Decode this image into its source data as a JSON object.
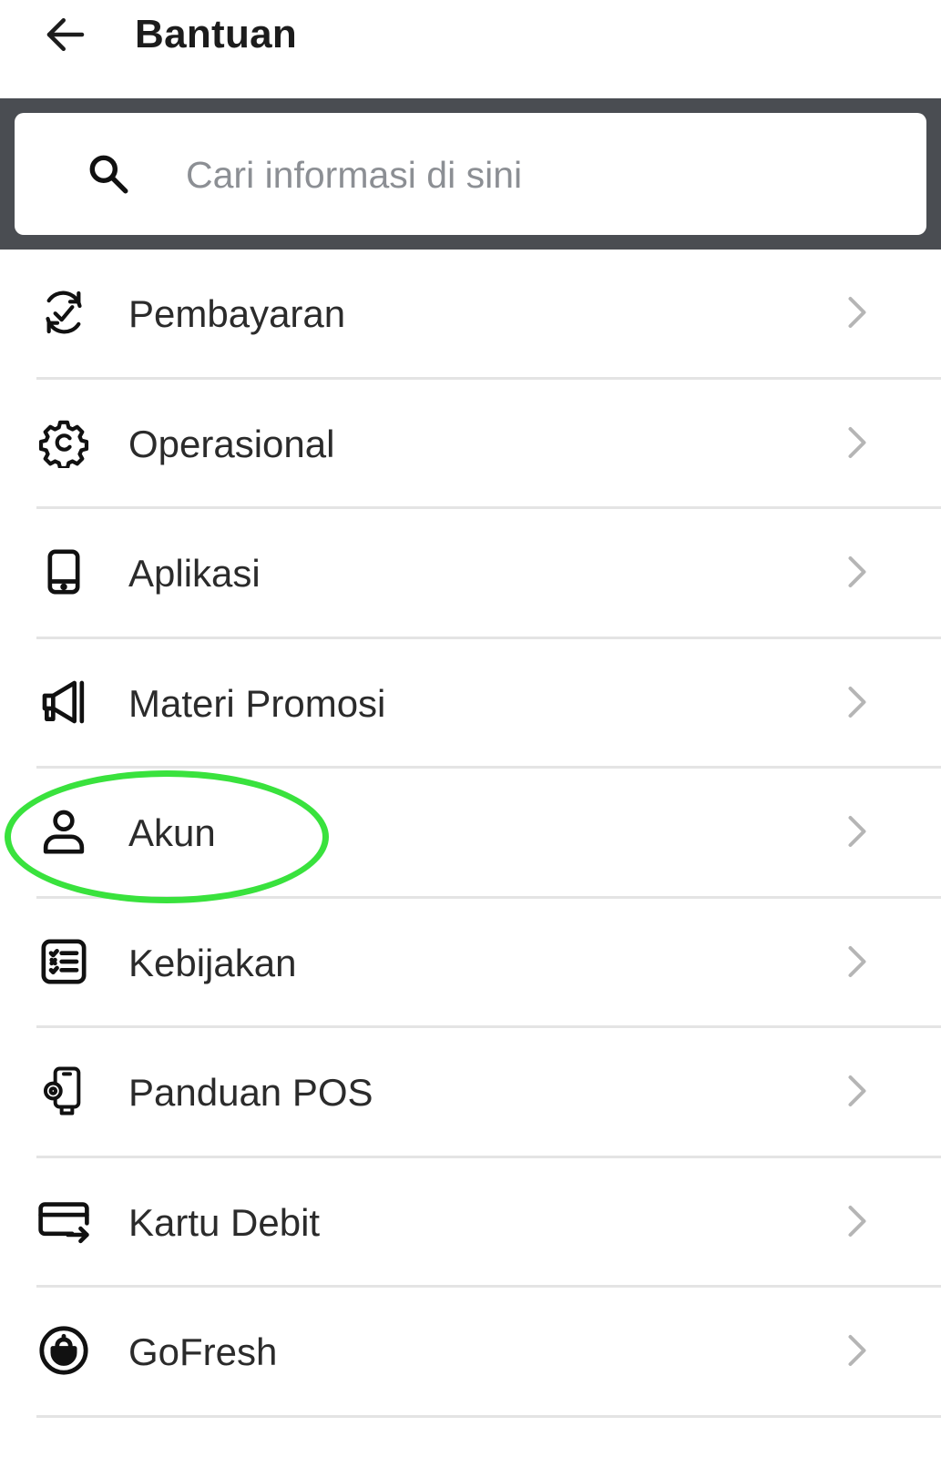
{
  "header": {
    "title": "Bantuan",
    "back_icon": "arrow-left-icon"
  },
  "search": {
    "placeholder": "Cari informasi di sini",
    "value": "",
    "icon": "search-icon"
  },
  "menu": {
    "items": [
      {
        "label": "Pembayaran",
        "icon": "payment-sync-icon"
      },
      {
        "label": "Operasional",
        "icon": "gear-icon"
      },
      {
        "label": "Aplikasi",
        "icon": "smartphone-icon"
      },
      {
        "label": "Materi Promosi",
        "icon": "megaphone-icon"
      },
      {
        "label": "Akun",
        "icon": "user-icon"
      },
      {
        "label": "Kebijakan",
        "icon": "checklist-icon"
      },
      {
        "label": "Panduan POS",
        "icon": "pos-device-icon"
      },
      {
        "label": "Kartu Debit",
        "icon": "card-transfer-icon"
      },
      {
        "label": "GoFresh",
        "icon": "gofresh-icon"
      }
    ],
    "chevron_icon": "chevron-right-icon"
  },
  "annotation": {
    "highlight_color": "#39e23d",
    "highlighted_item": "Akun"
  }
}
